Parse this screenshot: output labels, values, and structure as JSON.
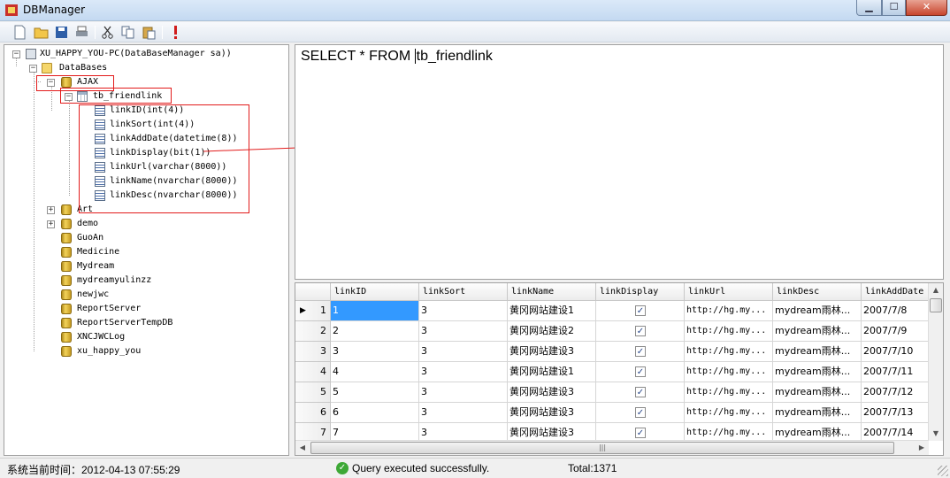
{
  "window": {
    "title": "DBManager",
    "min_glyph": "▁",
    "max_glyph": "☐",
    "close_glyph": "✕"
  },
  "toolbar": {
    "icons": [
      "new-icon",
      "open-icon",
      "save-icon",
      "print-icon",
      "cut-icon",
      "copy-icon",
      "paste-icon",
      "execute-icon"
    ]
  },
  "tree": {
    "server": "XU_HAPPY_YOU-PC(DataBaseManager sa))",
    "databases_folder": "DataBases",
    "selected_db": "AJAX",
    "table": "tb_friendlink",
    "columns": [
      "linkID(int(4))",
      "linkSort(int(4))",
      "linkAddDate(datetime(8))",
      "linkDisplay(bit(1))",
      "linkUrl(varchar(8000))",
      "linkName(nvarchar(8000))",
      "linkDesc(nvarchar(8000))"
    ],
    "other_dbs": [
      "Art",
      "demo",
      "GuoAn",
      "Medicine",
      "Mydream",
      "mydreamyulinzz",
      "newjwc",
      "ReportServer",
      "ReportServerTempDB",
      "XNCJWCLog",
      "xu_happy_you"
    ],
    "expander_plus": "+",
    "expander_minus": "−"
  },
  "query": {
    "text_before_cursor": "SELECT * FROM ",
    "text_after_cursor": "tb_friendlink"
  },
  "grid": {
    "columns": [
      "linkID",
      "linkSort",
      "linkName",
      "linkDisplay",
      "linkUrl",
      "linkDesc",
      "linkAddDate"
    ],
    "rows": [
      {
        "num": "1",
        "linkID": "1",
        "linkSort": "3",
        "linkName": "黄冈网站建设1",
        "linkDisplay": true,
        "linkUrl": "http://hg.my...",
        "linkDesc": "mydream雨林...",
        "linkAddDate": "2007/7/8"
      },
      {
        "num": "2",
        "linkID": "2",
        "linkSort": "3",
        "linkName": "黄冈网站建设2",
        "linkDisplay": true,
        "linkUrl": "http://hg.my...",
        "linkDesc": "mydream雨林...",
        "linkAddDate": "2007/7/9"
      },
      {
        "num": "3",
        "linkID": "3",
        "linkSort": "3",
        "linkName": "黄冈网站建设3",
        "linkDisplay": true,
        "linkUrl": "http://hg.my...",
        "linkDesc": "mydream雨林...",
        "linkAddDate": "2007/7/10"
      },
      {
        "num": "4",
        "linkID": "4",
        "linkSort": "3",
        "linkName": "黄冈网站建设1",
        "linkDisplay": true,
        "linkUrl": "http://hg.my...",
        "linkDesc": "mydream雨林...",
        "linkAddDate": "2007/7/11"
      },
      {
        "num": "5",
        "linkID": "5",
        "linkSort": "3",
        "linkName": "黄冈网站建设3",
        "linkDisplay": true,
        "linkUrl": "http://hg.my...",
        "linkDesc": "mydream雨林...",
        "linkAddDate": "2007/7/12"
      },
      {
        "num": "6",
        "linkID": "6",
        "linkSort": "3",
        "linkName": "黄冈网站建设3",
        "linkDisplay": true,
        "linkUrl": "http://hg.my...",
        "linkDesc": "mydream雨林...",
        "linkAddDate": "2007/7/13"
      },
      {
        "num": "7",
        "linkID": "7",
        "linkSort": "3",
        "linkName": "黄冈网站建设3",
        "linkDisplay": true,
        "linkUrl": "http://hg.my...",
        "linkDesc": "mydream雨林...",
        "linkAddDate": "2007/7/14"
      }
    ],
    "current_row_marker": "▶",
    "checkmark": "✓",
    "scroll_up": "▲",
    "scroll_down": "▼",
    "scroll_left": "◀",
    "scroll_right": "▶",
    "thumb_grip": "|||"
  },
  "status": {
    "time": "系统当前时间：2012-04-13 07:55:29",
    "message": "Query executed successfully.",
    "total": "Total:1371",
    "ok_glyph": "✓"
  },
  "colors": {
    "annotation_red": "#e21b1b",
    "selection_blue": "#3399ff"
  }
}
